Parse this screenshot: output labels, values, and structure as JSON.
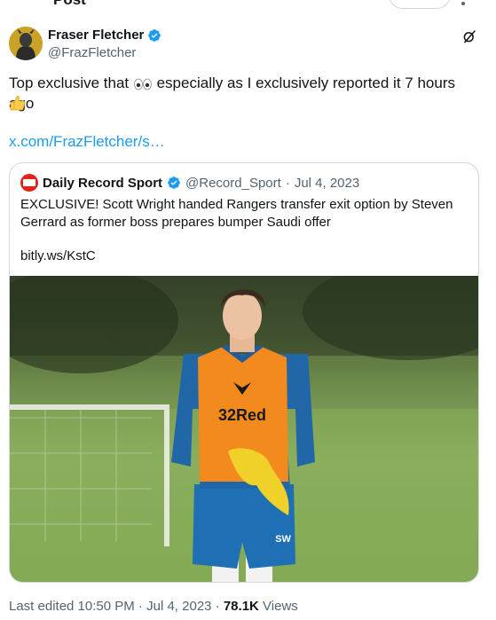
{
  "top_strip": {
    "title": "Post"
  },
  "author": {
    "display_name": "Fraser Fletcher",
    "handle": "@FrazFletcher",
    "verified": true
  },
  "post": {
    "text_before": "Top exclusive that",
    "text_after": " especially as I exclusively reported it 7 hours ago",
    "emoji_eyes": "eyes-emoji",
    "emoji_thumb": "thumbs-up-emoji",
    "link": "x.com/FrazFletcher/s…"
  },
  "quoted": {
    "display_name": "Daily Record Sport",
    "handle": "@Record_Sport",
    "separator": "·",
    "date": "Jul 4, 2023",
    "text": "EXCLUSIVE! Scott Wright handed Rangers transfer exit option by Steven Gerrard as former boss prepares bumper Saudi offer",
    "link": "bitly.ws/KstC",
    "image_alt": "Footballer in orange 32Red training bib",
    "bib_text": "32Red",
    "initials": "SW"
  },
  "footer": {
    "edited": "Last edited 10:50 PM",
    "sep1": " · ",
    "date": "Jul 4, 2023",
    "sep2": " · ",
    "views_count": "78.1K",
    "views_label": " Views"
  },
  "colors": {
    "accent": "#1d9bf0",
    "muted": "#536471",
    "text": "#0f1419",
    "border": "#cfd9de"
  }
}
